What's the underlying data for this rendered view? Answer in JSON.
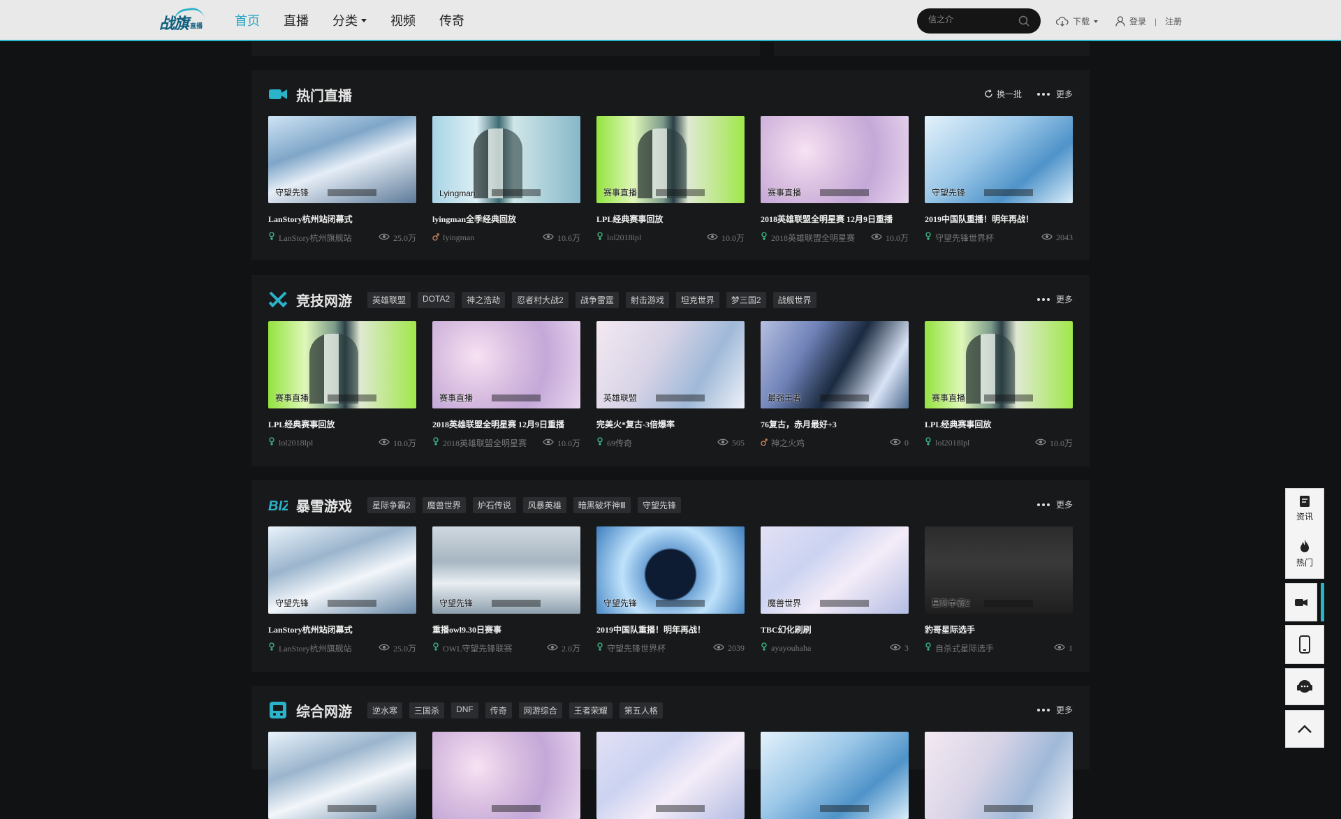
{
  "header": {
    "logo_text": "战旗",
    "logo_sub": "直播",
    "nav": [
      {
        "label": "首页",
        "active": true
      },
      {
        "label": "直播",
        "active": false
      },
      {
        "label": "分类",
        "active": false,
        "dropdown": true
      },
      {
        "label": "视频",
        "active": false
      },
      {
        "label": "传奇",
        "active": false
      }
    ],
    "search_placeholder": "信之介",
    "download_label": "下载",
    "login_label": "登录",
    "register_label": "注册",
    "separator": "|"
  },
  "sections": [
    {
      "id": "hot",
      "title": "热门直播",
      "icon": "video-camera-icon",
      "tags": [],
      "refresh_label": "换一批",
      "more_label": "更多",
      "cards": [
        {
          "title": "LanStory杭州站闭幕式",
          "category": "守望先锋",
          "anchor": "LanStory杭州旗舰站",
          "views": "25.0万",
          "gender": "female",
          "thumb": "t-ice"
        },
        {
          "title": "lyingman全季经典回放",
          "category": "Lyingman",
          "anchor": "lyingman",
          "views": "10.6万",
          "gender": "male",
          "thumb": "t-studio2"
        },
        {
          "title": "LPL经典赛事回放",
          "category": "赛事直播",
          "anchor": "lol2018lpl",
          "views": "10.0万",
          "gender": "female",
          "thumb": "t-studio"
        },
        {
          "title": "2018英雄联盟全明星赛 12月9日重播",
          "category": "赛事直播",
          "anchor": "2018英雄联盟全明星赛",
          "views": "10.0万",
          "gender": "female",
          "thumb": "t-pink"
        },
        {
          "title": "2019中国队重播！明年再战！",
          "category": "守望先锋",
          "anchor": "守望先锋世界杯",
          "views": "2043",
          "gender": "female",
          "thumb": "t-blue"
        }
      ]
    },
    {
      "id": "competitive",
      "title": "竞技网游",
      "icon": "crossed-swords-icon",
      "tags": [
        "英雄联盟",
        "DOTA2",
        "神之浩劫",
        "忍者村大战2",
        "战争雷霆",
        "射击游戏",
        "坦克世界",
        "梦三国2",
        "战舰世界"
      ],
      "more_label": "更多",
      "cards": [
        {
          "title": "LPL经典赛事回放",
          "category": "赛事直播",
          "anchor": "lol2018lpl",
          "views": "10.0万",
          "gender": "female",
          "thumb": "t-studio"
        },
        {
          "title": "2018英雄联盟全明星赛 12月9日重播",
          "category": "赛事直播",
          "anchor": "2018英雄联盟全明星赛",
          "views": "10.0万",
          "gender": "female",
          "thumb": "t-pink"
        },
        {
          "title": "完美火*复古-3倍爆率",
          "category": "英雄联盟",
          "anchor": "69传奇",
          "views": "505",
          "gender": "female",
          "thumb": "t-frozen"
        },
        {
          "title": "76复古，赤月最好+3",
          "category": "最强王者",
          "anchor": "神之火鸡",
          "views": "0",
          "gender": "male",
          "thumb": "t-dark"
        },
        {
          "title": "LPL经典赛事回放",
          "category": "赛事直播",
          "anchor": "lol2018lpl",
          "views": "10.0万",
          "gender": "female",
          "thumb": "t-studio"
        }
      ]
    },
    {
      "id": "blizzard",
      "title": "暴雪游戏",
      "icon": "blizzard-logo-icon",
      "tags": [
        "星际争霸2",
        "魔兽世界",
        "炉石传说",
        "风暴英雄",
        "暗黑破坏神Ⅲ",
        "守望先锋"
      ],
      "more_label": "更多",
      "cards": [
        {
          "title": "LanStory杭州站闭幕式",
          "category": "守望先锋",
          "anchor": "LanStory杭州旗舰站",
          "views": "25.0万",
          "gender": "female",
          "thumb": "t-snowy"
        },
        {
          "title": "重播owl9.30日赛事",
          "category": "守望先锋",
          "anchor": "OWL守望先锋联赛",
          "views": "2.0万",
          "gender": "female",
          "thumb": "t-room"
        },
        {
          "title": "2019中国队重播！明年再战！",
          "category": "守望先锋",
          "anchor": "守望先锋世界杯",
          "views": "2039",
          "gender": "female",
          "thumb": "t-scope"
        },
        {
          "title": "TBC幻化刷刷",
          "category": "魔兽世界",
          "anchor": "ayayouhaha",
          "views": "3",
          "gender": "female",
          "thumb": "t-wow"
        },
        {
          "title": "豹哥星际选手",
          "category": "星际争霸2",
          "anchor": "自杀式星际选手",
          "views": "1",
          "gender": "female",
          "thumb": "t-sc2"
        }
      ]
    },
    {
      "id": "mmo",
      "title": "综合网游",
      "icon": "gamepad-icon",
      "tags": [
        "逆水寒",
        "三国杀",
        "DNF",
        "传奇",
        "网游综合",
        "王者荣耀",
        "第五人格"
      ],
      "more_label": "更多",
      "cards": [
        {
          "thumb": "t-snowy"
        },
        {
          "thumb": "t-pink"
        },
        {
          "thumb": "t-wow"
        },
        {
          "thumb": "t-blue"
        },
        {
          "thumb": "t-frozen"
        }
      ]
    }
  ],
  "sidebar": {
    "news_label": "资讯",
    "hot_label": "热门"
  },
  "colors": {
    "accent": "#2bb3c9",
    "background": "#111214",
    "panel": "#18191b",
    "anchor_female": "#3fbf8a",
    "anchor_male": "#d9875a"
  }
}
